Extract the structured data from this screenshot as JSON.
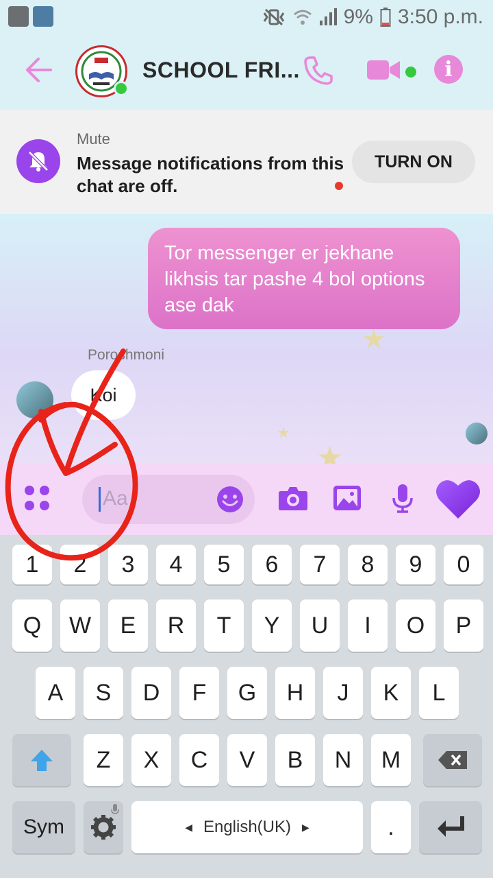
{
  "status_bar": {
    "battery": "9%",
    "time": "3:50 p.m.",
    "icons": [
      "app-icon-1",
      "app-icon-2",
      "mute-vibrate-icon",
      "wifi-icon",
      "signal-icon",
      "battery-icon"
    ]
  },
  "header": {
    "title": "SCHOOL FRI...",
    "icons": [
      "back-arrow-icon",
      "phone-icon",
      "video-camera-icon",
      "info-icon"
    ],
    "info_label": "i",
    "accent": "#e888d8"
  },
  "mute_banner": {
    "label": "Mute",
    "message": "Message notifications from this chat are off.",
    "button": "TURN ON",
    "icon": "bell-off-icon",
    "icon_color": "#9a44ec"
  },
  "chat": {
    "outgoing_message": "Tor messenger er jekhane likhsis tar pashe 4 bol options ase dak",
    "incoming_sender": "Poroshmoni",
    "incoming_message": "Koi"
  },
  "composer": {
    "placeholder": "Aa",
    "icons": [
      "menu-dots-icon",
      "emoji-icon",
      "camera-icon",
      "image-icon",
      "microphone-icon",
      "heart-icon"
    ],
    "accent": "#9a44ec"
  },
  "keyboard": {
    "row_numbers": [
      "1",
      "2",
      "3",
      "4",
      "5",
      "6",
      "7",
      "8",
      "9",
      "0"
    ],
    "row_1": [
      "Q",
      "W",
      "E",
      "R",
      "T",
      "Y",
      "U",
      "I",
      "O",
      "P"
    ],
    "row_2": [
      "A",
      "S",
      "D",
      "F",
      "G",
      "H",
      "J",
      "K",
      "L"
    ],
    "row_3": [
      "Z",
      "X",
      "C",
      "V",
      "B",
      "N",
      "M"
    ],
    "sym": "Sym",
    "space_label": "English(UK)",
    "period": "."
  },
  "annotation": {
    "color": "#e8231a",
    "shapes": [
      "circle",
      "arrow"
    ]
  }
}
